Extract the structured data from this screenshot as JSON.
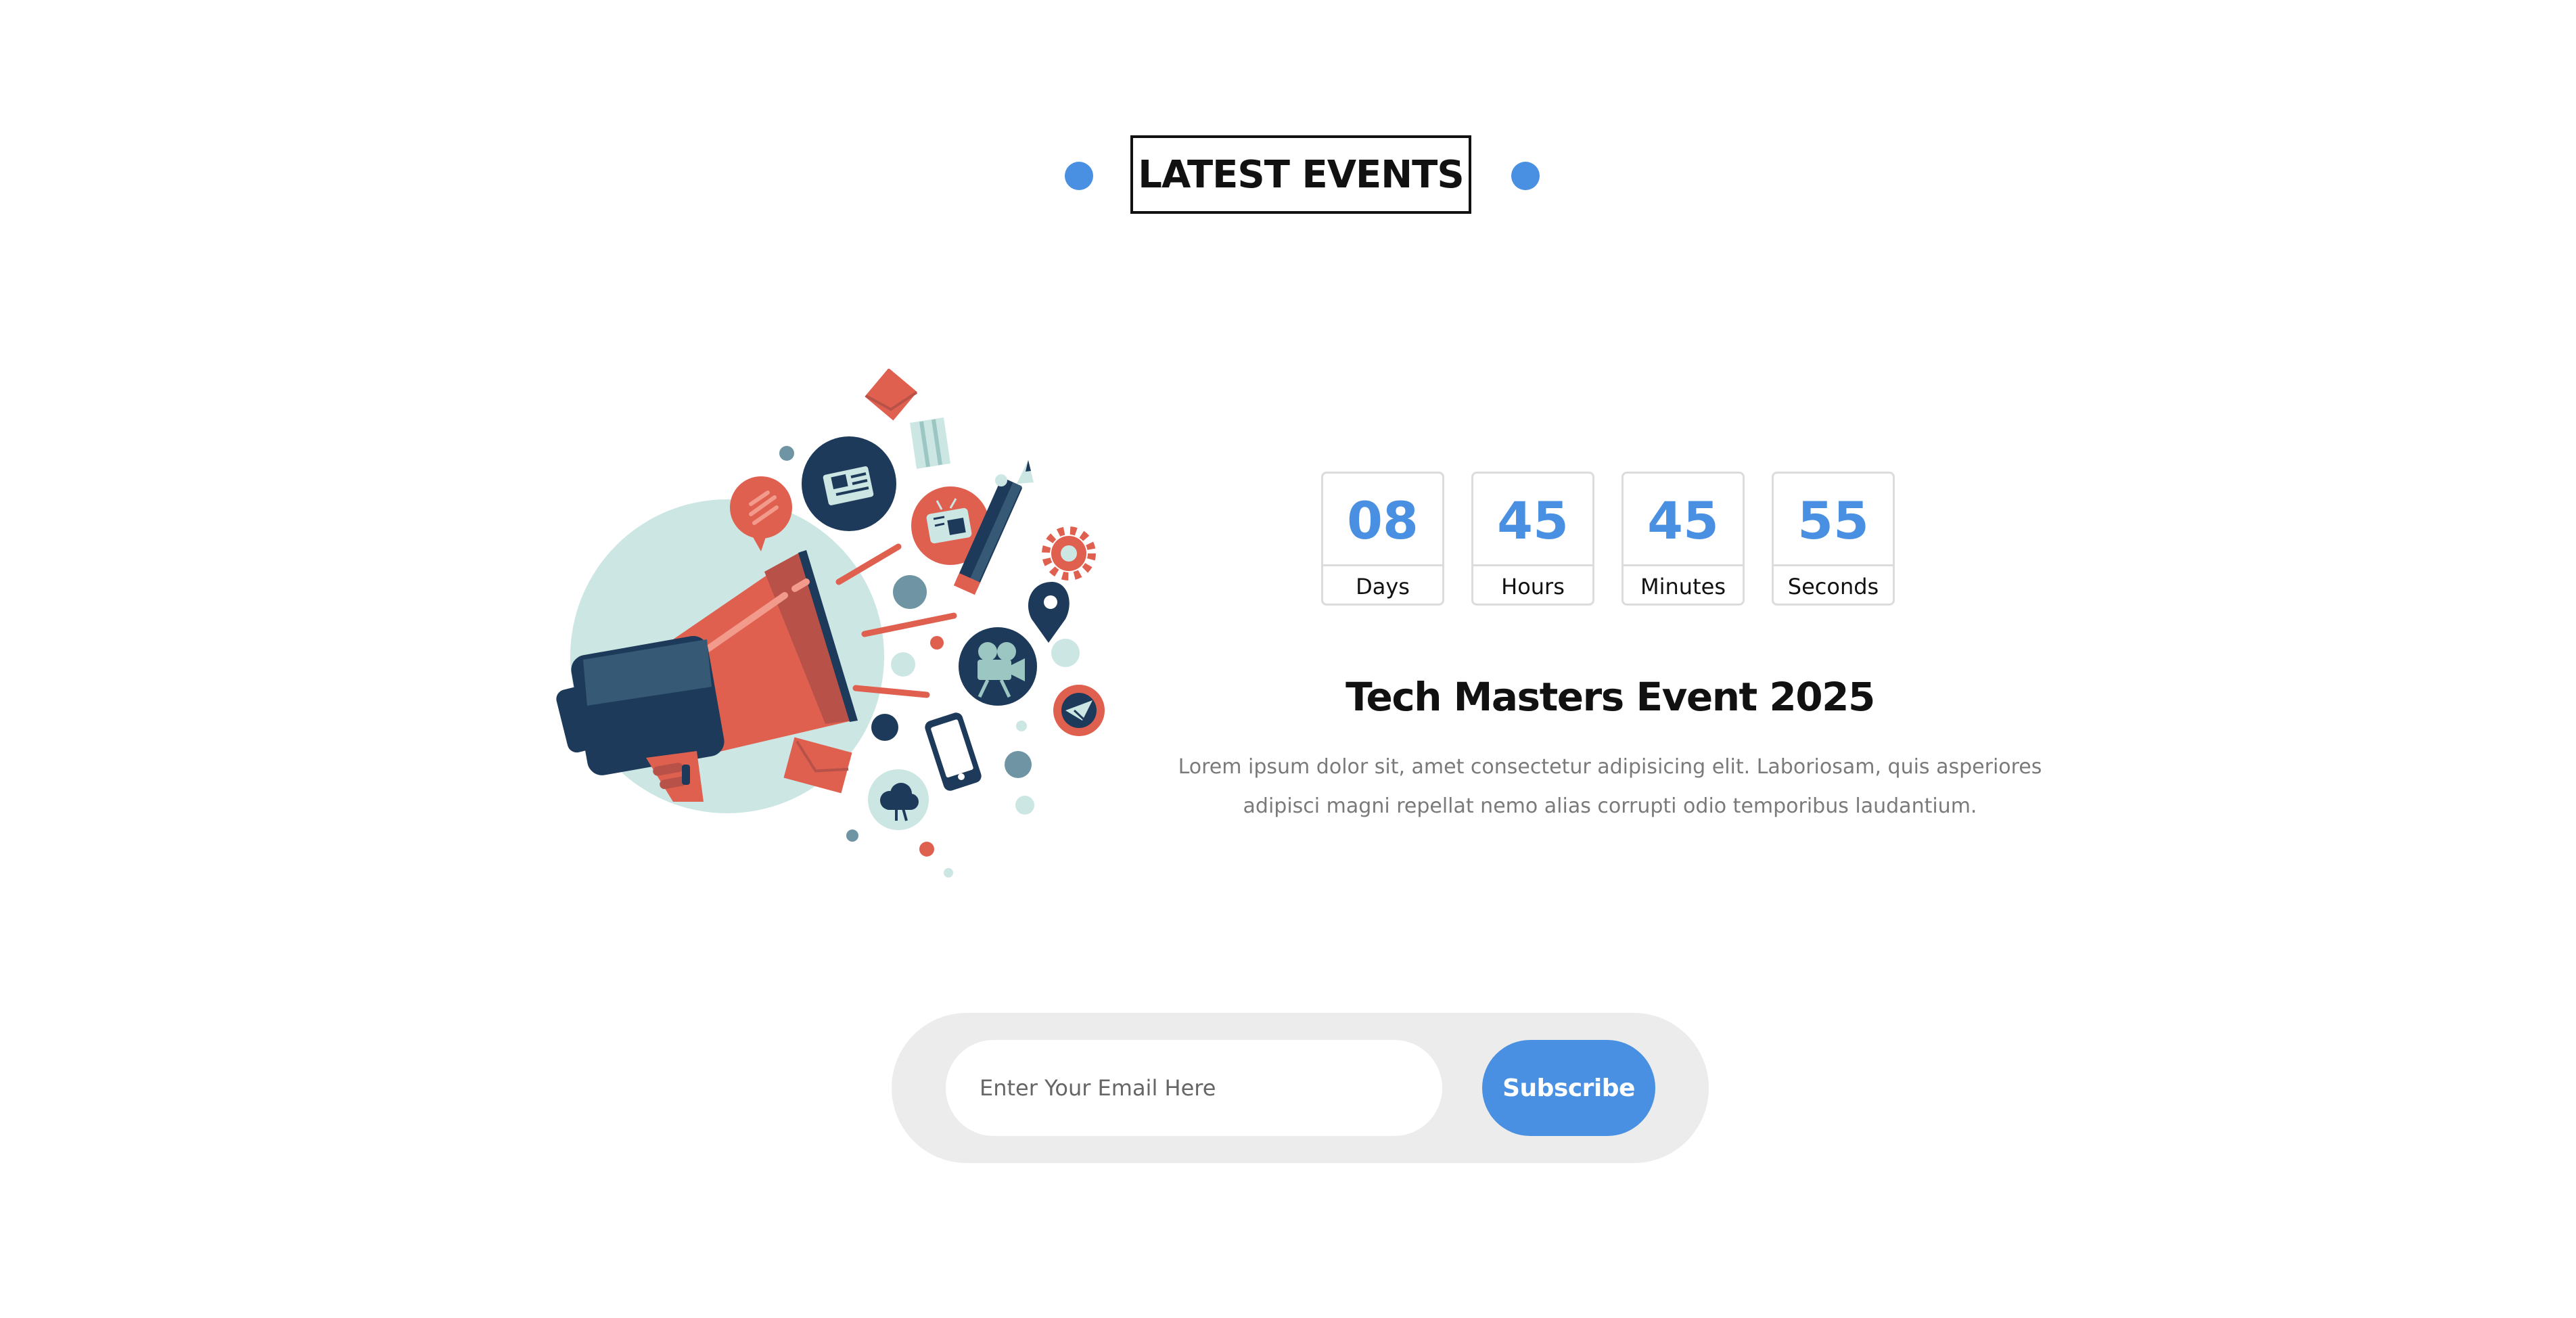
{
  "section": {
    "heading": "LATEST EVENTS"
  },
  "countdown": [
    {
      "value": "08",
      "label": "Days"
    },
    {
      "value": "45",
      "label": "Hours"
    },
    {
      "value": "45",
      "label": "Minutes"
    },
    {
      "value": "55",
      "label": "Seconds"
    }
  ],
  "event": {
    "title": "Tech Masters Event 2025",
    "description": "Lorem ipsum dolor sit, amet consectetur adipisicing elit. Laboriosam, quis asperiores adipisci magni repellat nemo alias corrupti odio temporibus laudantium."
  },
  "subscribe": {
    "placeholder": "Enter Your Email Here",
    "button_label": "Subscribe"
  },
  "colors": {
    "accent": "#4a90e2",
    "coral": "#e06050",
    "navy": "#1e3a5a",
    "mint": "#cce6e3"
  },
  "illustration": {
    "icons": [
      "megaphone-icon",
      "newspaper-icon",
      "tv-icon",
      "pencil-icon",
      "gear-icon",
      "location-pin-icon",
      "video-camera-icon",
      "smartphone-icon",
      "envelope-icon",
      "cloud-icon",
      "speech-bubble-icon",
      "map-icon",
      "paper-plane-icon"
    ]
  }
}
